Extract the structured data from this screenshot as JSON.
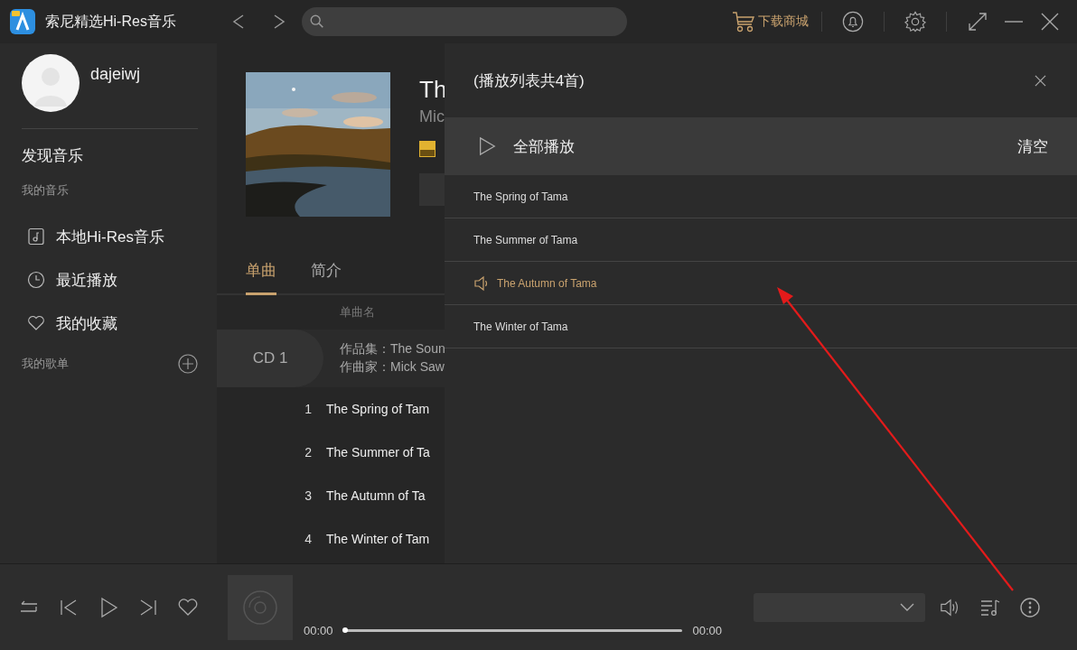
{
  "window": {
    "title": "索尼精选Hi-Res音乐"
  },
  "store_link": "下载商城",
  "user": {
    "name": "dajeiwj"
  },
  "sidebar": {
    "discover": "发现音乐",
    "my_music_heading": "我的音乐",
    "items": [
      {
        "label": "本地Hi-Res音乐",
        "kind": "hires"
      },
      {
        "label": "最近播放",
        "kind": "recent"
      },
      {
        "label": "我的收藏",
        "kind": "favorite"
      }
    ],
    "playlists_heading": "我的歌单"
  },
  "album": {
    "title": "Th",
    "artist": "Mic",
    "tabs": [
      {
        "label": "单曲",
        "selected": true
      },
      {
        "label": "简介",
        "selected": false
      }
    ],
    "column_header": "单曲名",
    "disc": {
      "label": "CD 1",
      "collection": "作品集：The Soun",
      "composer": "作曲家：Mick Saw"
    },
    "tracks": [
      {
        "number": "1",
        "title": "The Spring of Tam"
      },
      {
        "number": "2",
        "title": "The Summer of Ta"
      },
      {
        "number": "3",
        "title": "The Autumn of Ta"
      },
      {
        "number": "4",
        "title": "The Winter of Tam"
      }
    ]
  },
  "playlist": {
    "title": "(播放列表共4首)",
    "play_all": "全部播放",
    "clear": "清空",
    "items": [
      {
        "title": "The Spring of Tama",
        "playing": false
      },
      {
        "title": "The Summer of Tama",
        "playing": false
      },
      {
        "title": "The Autumn of Tama",
        "playing": true
      },
      {
        "title": "The Winter of Tama",
        "playing": false
      }
    ]
  },
  "player": {
    "elapsed": "00:00",
    "duration": "00:00",
    "progress": {
      "level": 0
    }
  }
}
